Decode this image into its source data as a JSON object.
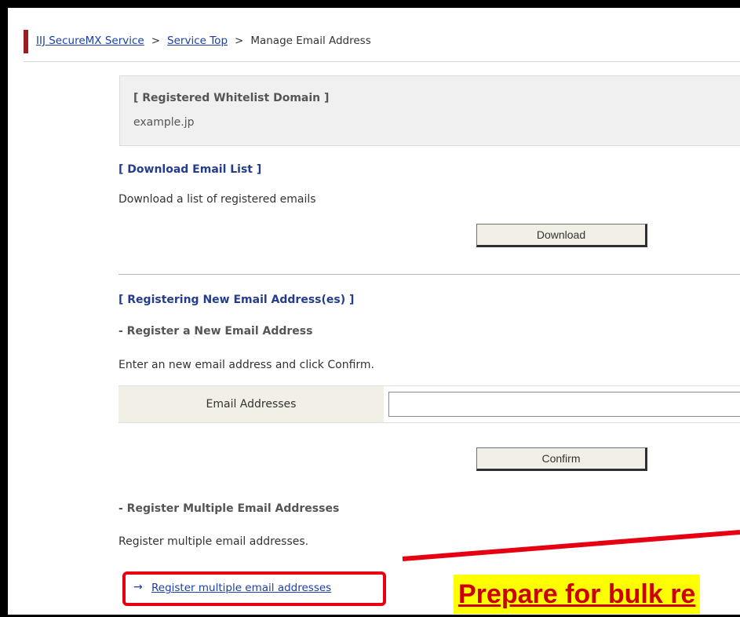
{
  "breadcrumb": {
    "items": [
      {
        "label": "IIJ SecureMX Service",
        "link": true
      },
      {
        "label": "Service Top",
        "link": true
      },
      {
        "label": "Manage Email Address",
        "link": false
      }
    ],
    "separator": ">"
  },
  "whitelist": {
    "title": "[ Registered Whitelist Domain ]",
    "domain": "example.jp"
  },
  "download": {
    "title": "[ Download Email List ]",
    "description": "Download a list of registered emails",
    "button_label": "Download"
  },
  "register": {
    "title": "[ Registering New Email Address(es) ]",
    "single": {
      "heading": "- Register a New Email Address",
      "instruction": "Enter an new email address and click Confirm.",
      "field_label": "Email Addresses",
      "field_value": "",
      "button_label": "Confirm"
    },
    "multiple": {
      "heading": "- Register Multiple Email Addresses",
      "description": "Register multiple email addresses.",
      "link_arrow": "→",
      "link_label": "Register multiple email addresses"
    }
  },
  "callout": {
    "text": "Prepare for bulk re",
    "text_color": "#cc0000",
    "highlight_color": "#ffff00",
    "line_color": "#e60012"
  },
  "colors": {
    "accent_bar": "#9b1d20",
    "section_title": "#243c8c",
    "link": "#1a3fa8"
  }
}
